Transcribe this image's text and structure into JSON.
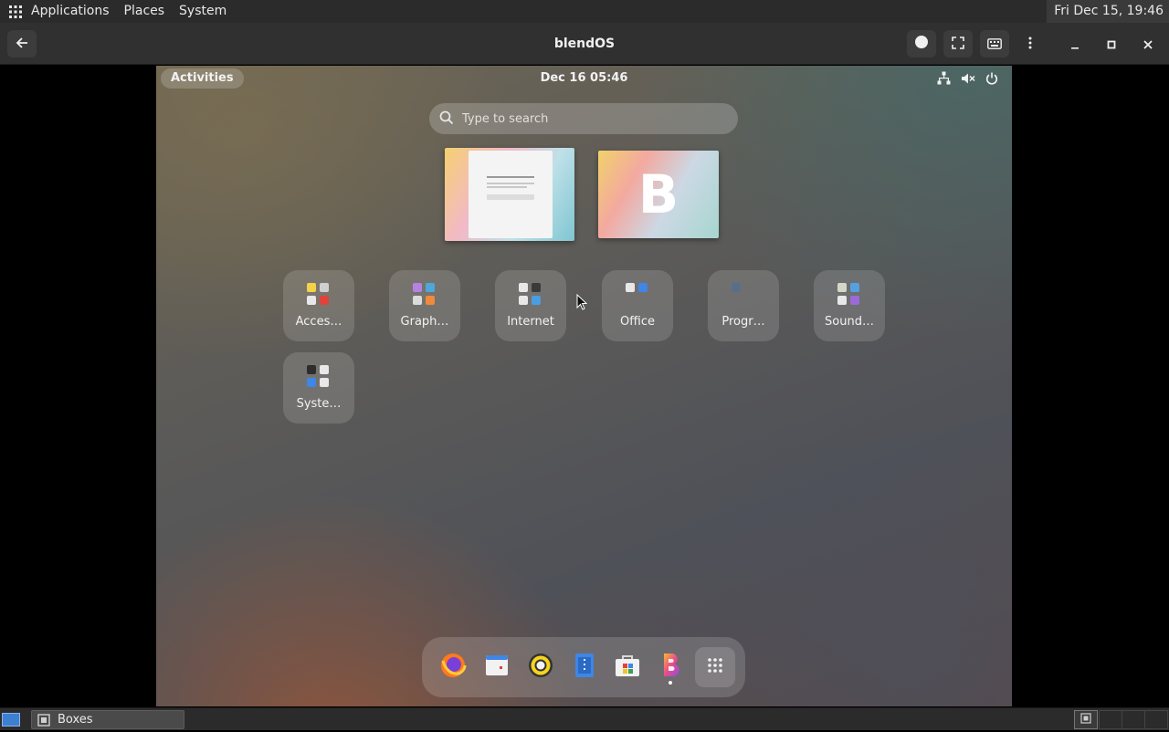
{
  "top_panel": {
    "menu": [
      "Applications",
      "Places",
      "System"
    ],
    "clock": "Fri Dec 15, 19:46"
  },
  "window": {
    "title": "blendOS"
  },
  "guest": {
    "activities": "Activities",
    "clock": "Dec 16  05:46",
    "search_placeholder": "Type to search",
    "workspace_logo": "B",
    "folders": [
      {
        "label": "Acces…",
        "colors": [
          "#f3d24a",
          "#cfcfcf",
          "#e8e8e8",
          "#e0433b"
        ]
      },
      {
        "label": "Graph…",
        "colors": [
          "#b483e0",
          "#4fa7d8",
          "#dcdcdc",
          "#f08a3c"
        ]
      },
      {
        "label": "Internet",
        "colors": [
          "#e8e8e8",
          "#3a3a3a",
          "#e8e8e8",
          "#4a9de0"
        ]
      },
      {
        "label": "Office",
        "colors": [
          "#e8e8e8",
          "#3f86e6",
          "#000000",
          "#000000"
        ]
      },
      {
        "label": "Progr…",
        "colors": [
          "#5a6e8c",
          "#000000",
          "#000000",
          "#000000"
        ]
      },
      {
        "label": "Sound…",
        "colors": [
          "#d6d6c8",
          "#56a0e0",
          "#e8e8e8",
          "#9b6ad8"
        ]
      },
      {
        "label": "Syste…",
        "colors": [
          "#2d2d2d",
          "#e8e8e8",
          "#3f86e6",
          "#e8e8e8"
        ]
      }
    ],
    "dock": [
      {
        "name": "firefox-icon"
      },
      {
        "name": "calendar-icon"
      },
      {
        "name": "rhythmbox-icon"
      },
      {
        "name": "text-editor-icon"
      },
      {
        "name": "software-store-icon"
      },
      {
        "name": "blendos-icon"
      },
      {
        "name": "app-grid-icon"
      }
    ]
  },
  "taskbar": {
    "task_label": "Boxes"
  }
}
